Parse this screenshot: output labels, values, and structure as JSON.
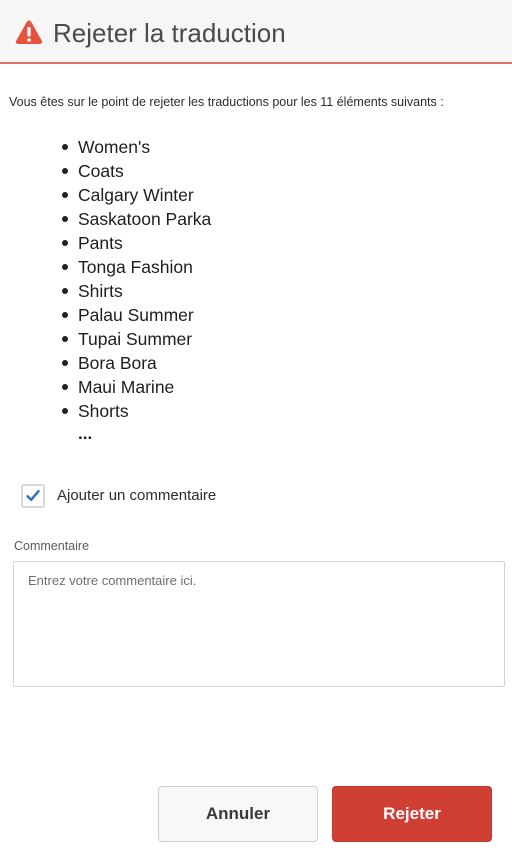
{
  "dialog": {
    "title": "Rejeter la traduction",
    "intro": "Vous êtes sur le point de rejeter les traductions pour les 11 éléments suivants :",
    "items": [
      "Women's",
      "Coats",
      "Calgary Winter",
      "Saskatoon Parka",
      "Pants",
      "Tonga Fashion",
      "Shirts",
      "Palau Summer",
      "Tupai Summer",
      "Bora Bora",
      "Maui Marine",
      "Shorts"
    ],
    "more_indicator": "...",
    "add_comment": {
      "label": "Ajouter un commentaire",
      "checked": true
    },
    "comment": {
      "label": "Commentaire",
      "placeholder": "Entrez votre commentaire ici.",
      "value": ""
    },
    "buttons": {
      "cancel": "Annuler",
      "reject": "Rejeter"
    }
  },
  "colors": {
    "warning_icon": "#e5533f",
    "header_border": "#e07165",
    "primary_button": "#d03f34",
    "checkmark": "#2e6fbf"
  },
  "icons": {
    "header": "alert-triangle-icon",
    "checkbox": "checkmark-icon"
  }
}
